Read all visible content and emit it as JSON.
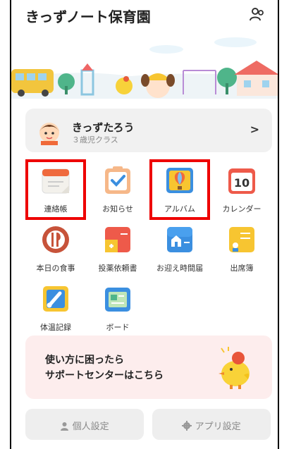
{
  "header": {
    "title": "きっずノート保育園",
    "account_icon": "user-switch-icon"
  },
  "profile": {
    "name": "きっずたろう",
    "class": "３歳児クラス",
    "chevron": ">"
  },
  "menu": [
    {
      "label": "連絡帳",
      "icon": "notebook-icon",
      "highlighted": true
    },
    {
      "label": "お知らせ",
      "icon": "clipboard-check-icon",
      "highlighted": false
    },
    {
      "label": "アルバム",
      "icon": "balloon-album-icon",
      "highlighted": true
    },
    {
      "label": "カレンダー",
      "icon": "calendar-icon",
      "day": "10",
      "highlighted": false
    },
    {
      "label": "本日の食事",
      "icon": "fork-knife-icon",
      "highlighted": false
    },
    {
      "label": "投薬依頼書",
      "icon": "medicine-form-icon",
      "highlighted": false
    },
    {
      "label": "お迎え時間届",
      "icon": "house-pickup-icon",
      "highlighted": false
    },
    {
      "label": "出席簿",
      "icon": "attendance-icon",
      "highlighted": false
    },
    {
      "label": "体温記録",
      "icon": "thermometer-icon",
      "highlighted": false
    },
    {
      "label": "ボード",
      "icon": "board-icon",
      "highlighted": false
    }
  ],
  "support": {
    "line1": "使い方に困ったら",
    "line2": "サポートセンターはこちら"
  },
  "footer": {
    "personal_settings": "個人設定",
    "app_settings": "アプリ設定"
  },
  "colors": {
    "accent": "#e60000",
    "orange": "#f06a3a",
    "blue": "#3b8fe0",
    "yellow": "#f7c531",
    "support_bg": "#fdeded"
  }
}
